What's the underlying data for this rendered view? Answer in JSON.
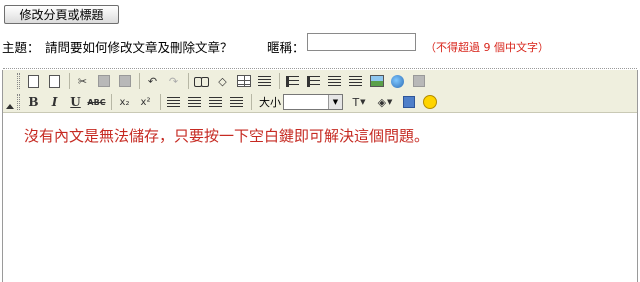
{
  "top_button": {
    "label": "修改分頁或標題"
  },
  "subject": {
    "label": "主題：",
    "value": "請問要如何修改文章及刪除文章？"
  },
  "nickname": {
    "label": "暱稱：",
    "value": "",
    "note": "（不得超過 9 個中文字）"
  },
  "toolbar": {
    "font_size_label": "大小",
    "font_size_value": ""
  },
  "editor": {
    "content": "沒有內文是無法儲存，只要按一下空白鍵即可解決這個問題。"
  },
  "colors": {
    "note": "#d8261c",
    "content_text": "#c62a22",
    "toolbar_bg": "#efefde"
  }
}
